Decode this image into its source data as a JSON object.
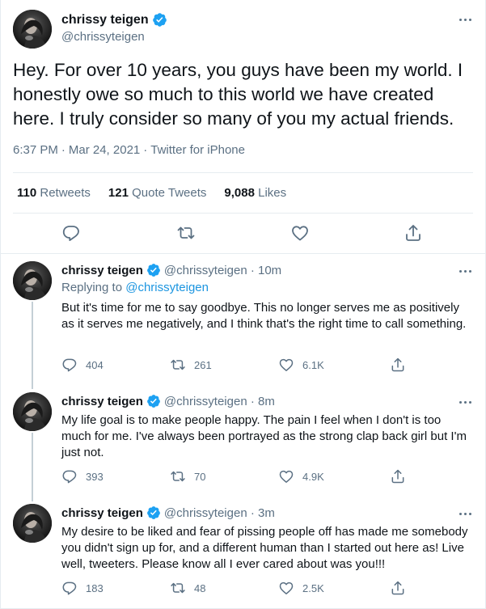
{
  "colors": {
    "accent": "#1da1f2",
    "link": "#1b95e0",
    "secondary_text": "#5b7083",
    "border": "#e6ecf0"
  },
  "main_tweet": {
    "name": "chrissy teigen",
    "handle": "@chrissyteigen",
    "text": "Hey. For over 10 years, you guys have been my world. I honestly owe so much to this world we have created here. I truly consider so many of you my actual friends.",
    "time": "6:37 PM",
    "dot1": "·",
    "date": "Mar 24, 2021",
    "dot2": "·",
    "source": "Twitter for iPhone",
    "stats": {
      "retweets_count": "110",
      "retweets_label": "Retweets",
      "quotes_count": "121",
      "quotes_label": "Quote Tweets",
      "likes_count": "9,088",
      "likes_label": "Likes"
    },
    "icons": [
      "reply-icon",
      "retweet-icon",
      "like-icon",
      "share-icon"
    ]
  },
  "replies": [
    {
      "name": "chrissy teigen",
      "handle": "@chrissyteigen · 10m",
      "replying_prefix": "Replying to",
      "replying_to": "@chrissyteigen",
      "text": "But it's time for me to say goodbye. This no longer serves me as positively as it serves me negatively, and I think that's the right time to call something.",
      "reply_count": "404",
      "retweet_count": "261",
      "like_count": "6.1K"
    },
    {
      "name": "chrissy teigen",
      "handle": "@chrissyteigen · 8m",
      "text": "My life goal is to make people happy. The pain I feel when I don't is too much for me. I've always been portrayed as the strong clap back girl but I'm just not.",
      "reply_count": "393",
      "retweet_count": "70",
      "like_count": "4.9K"
    },
    {
      "name": "chrissy teigen",
      "handle": "@chrissyteigen · 3m",
      "text": "My desire to be liked and fear of pissing people off has made me somebody you didn't sign up for, and a different human than I started out here as! Live well, tweeters. Please know all I ever cared about was you!!!",
      "reply_count": "183",
      "retweet_count": "48",
      "like_count": "2.5K"
    }
  ]
}
